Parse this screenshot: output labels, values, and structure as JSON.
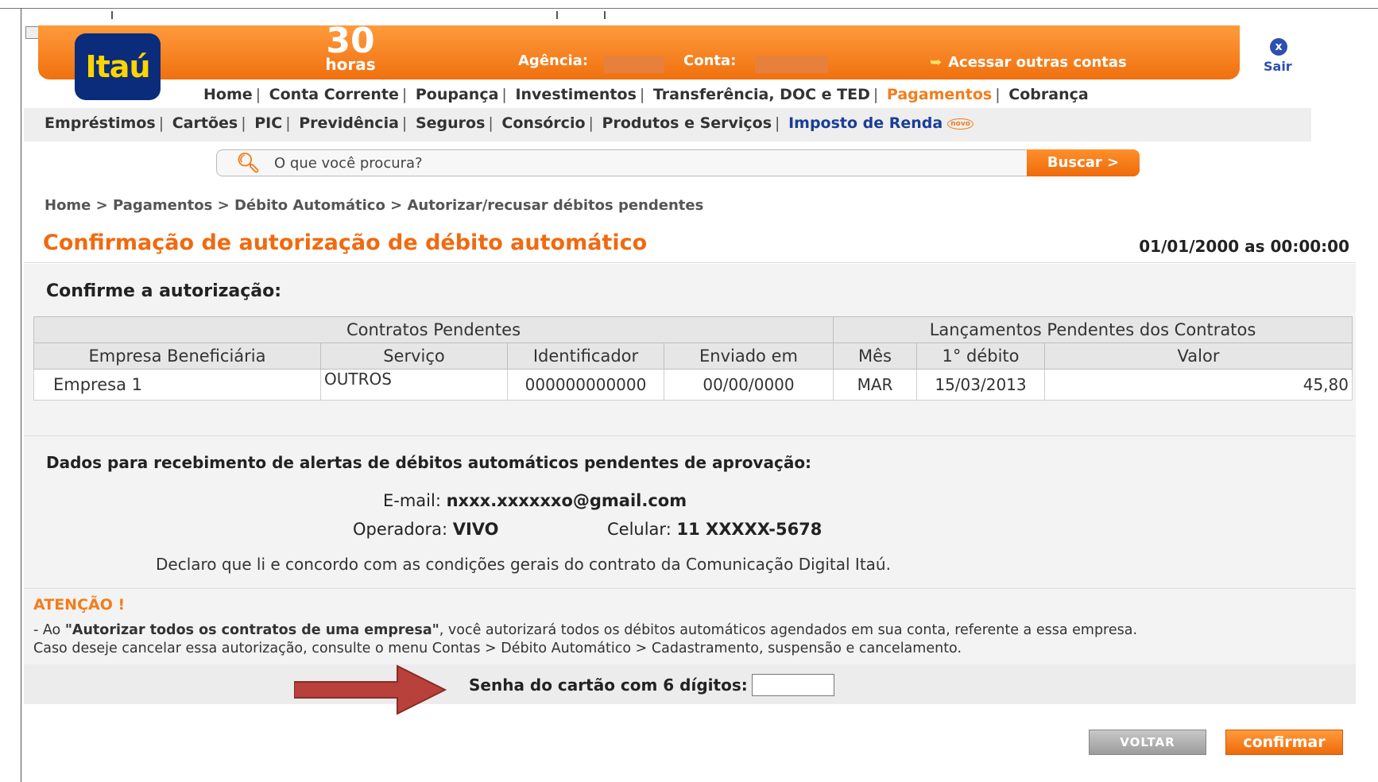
{
  "header": {
    "logo_text": "Itaú",
    "badge_number": "30",
    "badge_label": "horas",
    "agencia_label": "Agência:",
    "conta_label": "Conta:",
    "outras_contas": "Acessar outras contas",
    "sair": "Sair",
    "sair_icon_glyph": "x"
  },
  "nav": {
    "row1": [
      "Home",
      "Conta Corrente",
      "Poupança",
      "Investimentos",
      "Transferência, DOC e TED",
      "Pagamentos",
      "Cobrança"
    ],
    "row2": [
      "Empréstimos",
      "Cartões",
      "PIC",
      "Previdência",
      "Seguros",
      "Consórcio",
      "Produtos e Serviços",
      "Imposto de Renda"
    ],
    "novo_badge": "novo",
    "active": "Pagamentos"
  },
  "search": {
    "placeholder": "O que você procura?",
    "button": "Buscar >"
  },
  "breadcrumb": "Home > Pagamentos > Débito Automático > Autorizar/recusar débitos pendentes",
  "page": {
    "title": "Confirmação de autorização de débito automático",
    "datetime": "01/01/2000 as 00:00:00",
    "confirm_heading": "Confirme a autorização:"
  },
  "table": {
    "group_headers": [
      "Contratos Pendentes",
      "Lançamentos Pendentes dos Contratos"
    ],
    "columns": [
      "Empresa Beneficiária",
      "Serviço",
      "Identificador",
      "Enviado em",
      "Mês",
      "1° débito",
      "Valor"
    ],
    "rows": [
      [
        "Empresa 1",
        "OUTROS",
        "000000000000",
        "00/00/0000",
        "MAR",
        "15/03/2013",
        "45,80"
      ]
    ]
  },
  "alerts": {
    "heading": "Dados para recebimento de alertas de débitos automáticos pendentes de aprovação:",
    "email_label": "E-mail:",
    "email_value": "nxxx.xxxxxxo@gmail.com",
    "operadora_label": "Operadora:",
    "operadora_value": "VIVO",
    "celular_label": "Celular:",
    "celular_value": "11 XXXXX-5678",
    "declaro": "Declaro que li e concordo com as condições gerais do contrato da Comunicação Digital Itaú."
  },
  "attention": {
    "title": "ATENÇÃO",
    "mark": "!",
    "prefix": "- Ao ",
    "bold_text": "\"Autorizar todos os contratos de uma empresa\"",
    "line1_rest": ", você autorizará todos os débitos automáticos agendados em sua conta, referente a essa empresa.",
    "line2": "Caso deseje cancelar essa autorização, consulte o menu Contas > Débito Automático > Cadastramento, suspensão e cancelamento."
  },
  "senha": {
    "label": "Senha do cartão com 6 dígitos:",
    "value": ""
  },
  "buttons": {
    "voltar": "VOLTAR",
    "confirmar": "confirmar"
  },
  "colors": {
    "brand_orange": "#f27d1b",
    "brand_blue": "#0a2c7a",
    "logo_yellow": "#ffd400",
    "arrow_red": "#b8413b"
  }
}
